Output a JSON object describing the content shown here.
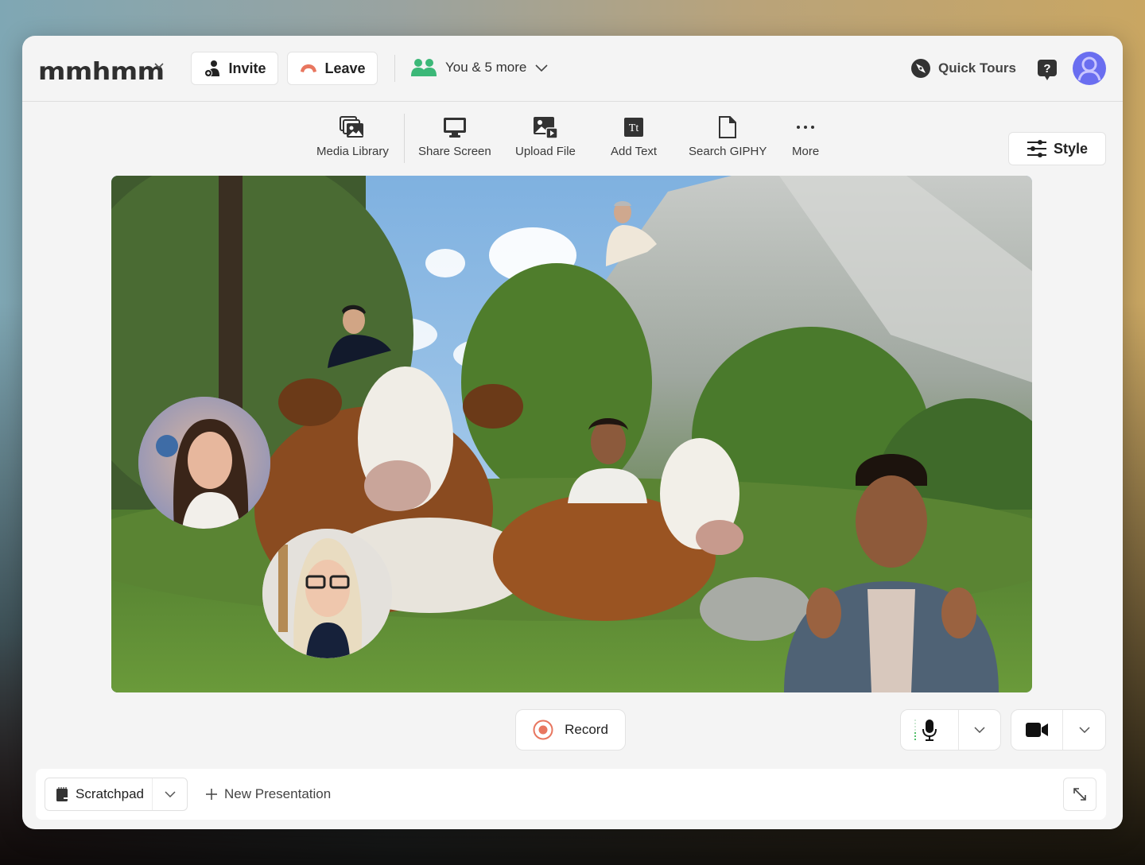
{
  "app": {
    "logo": "mmhmm"
  },
  "topbar": {
    "invite_label": "Invite",
    "leave_label": "Leave",
    "participants_label": "You & 5 more",
    "quick_tours_label": "Quick Tours",
    "help_icon": "question-bubble-icon",
    "avatar_icon": "user-avatar-icon"
  },
  "toolbar": {
    "items": [
      {
        "label": "Media Library",
        "icon": "media-library-icon"
      },
      {
        "label": "Share Screen",
        "icon": "monitor-icon"
      },
      {
        "label": "Upload File",
        "icon": "upload-file-icon"
      },
      {
        "label": "Add Text",
        "icon": "text-icon"
      },
      {
        "label": "Search GIPHY",
        "icon": "file-icon"
      },
      {
        "label": "More",
        "icon": "more-dots-icon"
      }
    ],
    "style_label": "Style"
  },
  "stage": {
    "scene": "Alpine meadow with cows and mountains",
    "participants_visible": 6
  },
  "controls": {
    "record_label": "Record",
    "mic_icon": "microphone-icon",
    "camera_icon": "video-camera-icon"
  },
  "bottom": {
    "presentation_label": "Scratchpad",
    "new_presentation_label": "New Presentation"
  },
  "colors": {
    "accent_green": "#3cb878",
    "leave_red": "#e8765f",
    "record_red": "#e8765f",
    "avatar_purple": "#6a6ef0"
  }
}
